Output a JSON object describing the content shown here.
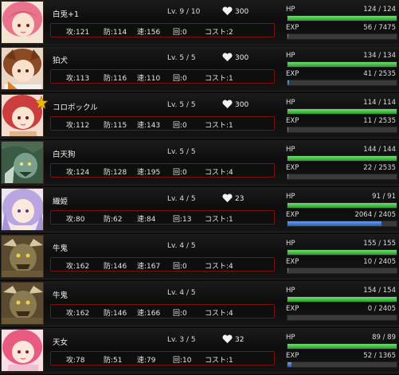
{
  "units": [
    {
      "name": "白兎+1",
      "level": "Lv. 9 / 10",
      "hearts": "300",
      "atk": "攻:121",
      "def": "防:114",
      "spd": "速:156",
      "rec": "回:0",
      "cost": "コスト:2",
      "hp_label": "HP",
      "hp": "124 / 124",
      "hp_ratio": 1.0,
      "exp_label": "EXP",
      "exp": "56 / 7475",
      "exp_ratio": 0.0075,
      "favorite": false,
      "portrait": "pink-haired-girl"
    },
    {
      "name": "狛犬",
      "level": "Lv. 5 / 5",
      "hearts": "300",
      "atk": "攻:113",
      "def": "防:116",
      "spd": "速:110",
      "rec": "回:0",
      "cost": "コスト:1",
      "hp_label": "HP",
      "hp": "134 / 134",
      "hp_ratio": 1.0,
      "exp_label": "EXP",
      "exp": "41 / 2535",
      "exp_ratio": 0.016,
      "favorite": false,
      "portrait": "brown-haired-dog-girl"
    },
    {
      "name": "コロポックル",
      "level": "Lv. 5 / 5",
      "hearts": "300",
      "atk": "攻:112",
      "def": "防:115",
      "spd": "速:143",
      "rec": "回:0",
      "cost": "コスト:1",
      "hp_label": "HP",
      "hp": "114 / 114",
      "hp_ratio": 1.0,
      "exp_label": "EXP",
      "exp": "11 / 2535",
      "exp_ratio": 0.004,
      "favorite": true,
      "portrait": "red-haired-girl"
    },
    {
      "name": "白天狗",
      "level": "Lv. 5 / 5",
      "hearts": "",
      "atk": "攻:124",
      "def": "防:128",
      "spd": "速:195",
      "rec": "回:0",
      "cost": "コスト:4",
      "hp_label": "HP",
      "hp": "144 / 144",
      "hp_ratio": 1.0,
      "exp_label": "EXP",
      "exp": "22 / 2535",
      "exp_ratio": 0.009,
      "favorite": false,
      "portrait": "green-tengu"
    },
    {
      "name": "織姫",
      "level": "Lv. 4 / 5",
      "hearts": "23",
      "atk": "攻:80",
      "def": "防:62",
      "spd": "速:84",
      "rec": "回:13",
      "cost": "コスト:1",
      "hp_label": "HP",
      "hp": "91 / 91",
      "hp_ratio": 1.0,
      "exp_label": "EXP",
      "exp": "2064 / 2405",
      "exp_ratio": 0.858,
      "favorite": false,
      "portrait": "lavender-haired-princess"
    },
    {
      "name": "牛鬼",
      "level": "Lv. 4 / 5",
      "hearts": "",
      "atk": "攻:162",
      "def": "防:146",
      "spd": "速:167",
      "rec": "回:0",
      "cost": "コスト:4",
      "hp_label": "HP",
      "hp": "155 / 155",
      "hp_ratio": 1.0,
      "exp_label": "EXP",
      "exp": "10 / 2405",
      "exp_ratio": 0.004,
      "favorite": false,
      "portrait": "ushi-oni-beast"
    },
    {
      "name": "牛鬼",
      "level": "Lv. 4 / 5",
      "hearts": "",
      "atk": "攻:162",
      "def": "防:146",
      "spd": "速:166",
      "rec": "回:0",
      "cost": "コスト:4",
      "hp_label": "HP",
      "hp": "154 / 154",
      "hp_ratio": 1.0,
      "exp_label": "EXP",
      "exp": "0 / 2405",
      "exp_ratio": 0.0,
      "favorite": false,
      "portrait": "ushi-oni-beast"
    },
    {
      "name": "天女",
      "level": "Lv. 3 / 5",
      "hearts": "32",
      "atk": "攻:78",
      "def": "防:51",
      "spd": "速:79",
      "rec": "回:10",
      "cost": "コスト:1",
      "hp_label": "HP",
      "hp": "89 / 89",
      "hp_ratio": 1.0,
      "exp_label": "EXP",
      "exp": "52 / 1365",
      "exp_ratio": 0.038,
      "favorite": false,
      "portrait": "pink-haired-celestial"
    }
  ],
  "colors": {
    "hp_bar": "#3cb43c",
    "exp_bar": "#3a6fd0",
    "stat_border": "#7a1010",
    "star": "#f2b800"
  }
}
